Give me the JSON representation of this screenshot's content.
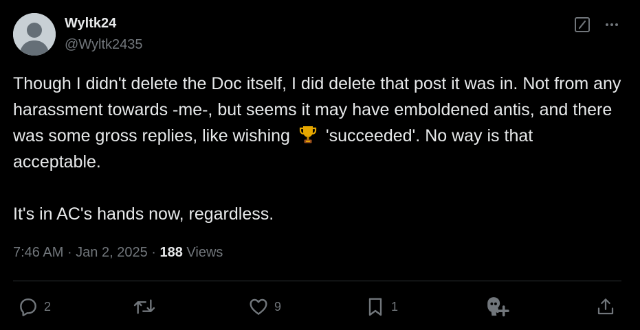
{
  "author": {
    "name": "Wyltk24",
    "handle": "@Wyltk2435"
  },
  "header_icons": {
    "grok": "grok-slash-icon",
    "more": "more-icon"
  },
  "tweet": {
    "paragraphs": [
      {
        "before_emoji": "Though I didn't delete the Doc itself, I did delete that post it was in. Not from any harassment towards -me-, but seems it may have emboldened antis, and there was some gross replies, like wishing ",
        "emoji": "🏆",
        "after_emoji": " 'succeeded'. No way is that acceptable."
      },
      {
        "text": "It's in AC's hands now, regardless."
      }
    ]
  },
  "meta": {
    "time": "7:46 AM",
    "sep1": " · ",
    "date": "Jan 2, 2025",
    "sep2": " · ",
    "views_count": "188",
    "views_label": " Views"
  },
  "actions": {
    "reply": {
      "icon": "reply-icon",
      "count": "2"
    },
    "retweet": {
      "icon": "retweet-icon",
      "count": ""
    },
    "like": {
      "icon": "heart-icon",
      "count": "9"
    },
    "bookmark": {
      "icon": "bookmark-icon",
      "count": "1"
    },
    "grok": {
      "icon": "grok-person-plus-icon"
    },
    "share": {
      "icon": "share-icon"
    }
  },
  "colors": {
    "background": "#000000",
    "text_primary": "#e7e9ea",
    "text_secondary": "#71767b",
    "divider": "#2f3336",
    "avatar_bg": "#c8d0d5",
    "trophy": "#e6a700"
  }
}
